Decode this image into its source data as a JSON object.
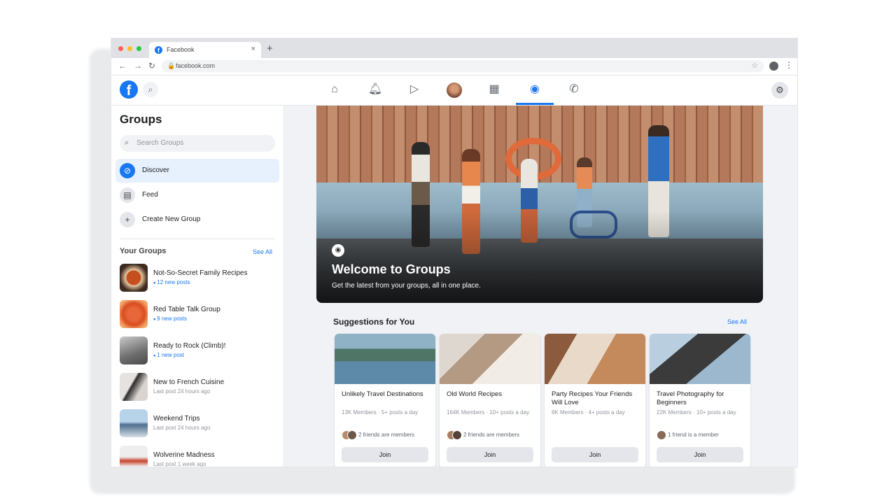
{
  "browser": {
    "tab_title": "Facebook",
    "tab_close": "×",
    "new_tab": "+",
    "url": "facebook.com"
  },
  "sidebar": {
    "title": "Groups",
    "search_placeholder": "Search Groups",
    "items": [
      {
        "label": "Discover",
        "icon": "compass-icon"
      },
      {
        "label": "Feed",
        "icon": "feed-icon"
      },
      {
        "label": "Create New Group",
        "icon": "plus-icon"
      }
    ],
    "your_groups_label": "Your Groups",
    "see_all": "See All",
    "groups": [
      {
        "name": "Not-So-Secret Family Recipes",
        "meta": "12 new posts",
        "is_new": true
      },
      {
        "name": "Red Table Talk Group",
        "meta": "9 new posts",
        "is_new": true
      },
      {
        "name": "Ready to Rock (Climb)!",
        "meta": "1 new post",
        "is_new": true
      },
      {
        "name": "New to French Cuisine",
        "meta": "Last post 24 hours ago",
        "is_new": false
      },
      {
        "name": "Weekend Trips",
        "meta": "Last post 24 hours ago",
        "is_new": false
      },
      {
        "name": "Wolverine Madness",
        "meta": "Last post 1 week ago",
        "is_new": false
      }
    ]
  },
  "hero": {
    "title": "Welcome to Groups",
    "subtitle": "Get the latest from your groups, all in one place."
  },
  "suggestions": {
    "title": "Suggestions for You",
    "see_all": "See All",
    "join_label": "Join",
    "cards": [
      {
        "name": "Unlikely Travel Destinations",
        "meta": "13K Members · 5+ posts a day",
        "friends": "2 friends are members"
      },
      {
        "name": "Old World Recipes",
        "meta": "164K Members · 10+ posts a day",
        "friends": "2 friends are members"
      },
      {
        "name": "Party Recipes Your Friends Will Love",
        "meta": "9K Members · 4+ posts a day",
        "friends": ""
      },
      {
        "name": "Travel Photography for Beginners",
        "meta": "22K Members · 10+ posts a day",
        "friends": "1 friend is a member"
      }
    ]
  },
  "colors": {
    "brand": "#1877f2",
    "background": "#f0f2f5"
  }
}
